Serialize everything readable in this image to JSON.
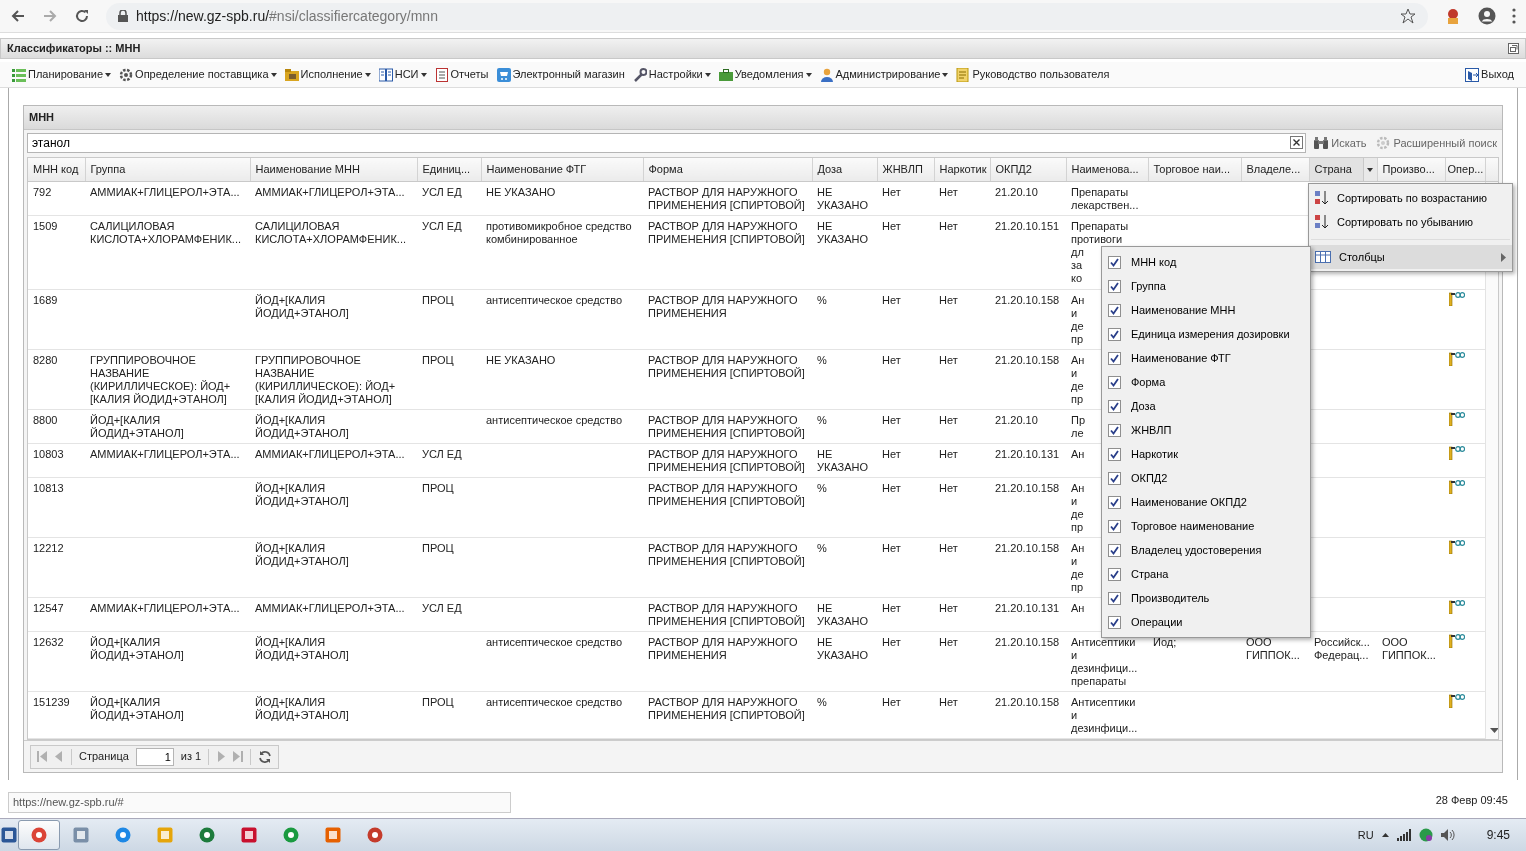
{
  "browser": {
    "url_host": "https://new.gz-spb.ru/",
    "url_path": "#nsi/classifiercategory/mnn"
  },
  "app": {
    "title": "Классификаторы :: МНН"
  },
  "menu": [
    {
      "label": "Планирование",
      "dropdown": true
    },
    {
      "label": "Определение поставщика",
      "dropdown": true
    },
    {
      "label": "Исполнение",
      "dropdown": true
    },
    {
      "label": "НСИ",
      "dropdown": true
    },
    {
      "label": "Отчеты",
      "dropdown": false
    },
    {
      "label": "Электронный магазин",
      "dropdown": false
    },
    {
      "label": "Настройки",
      "dropdown": true
    },
    {
      "label": "Уведомления",
      "dropdown": true
    },
    {
      "label": "Администрирование",
      "dropdown": true
    },
    {
      "label": "Руководство пользователя",
      "dropdown": false
    }
  ],
  "logout": "Выход",
  "panel": {
    "title": "МНН",
    "search_value": "этанол",
    "search_button": "Искать",
    "advanced_search": "Расширенный поиск"
  },
  "columns": [
    {
      "label": "МНН код",
      "menu_open": false
    },
    {
      "label": "Группа",
      "menu_open": false
    },
    {
      "label": "Наименование МНН",
      "menu_open": false
    },
    {
      "label": "Единиц...",
      "menu_open": false
    },
    {
      "label": "Наименование ФТГ",
      "menu_open": false
    },
    {
      "label": "Форма",
      "menu_open": false
    },
    {
      "label": "Доза",
      "menu_open": false
    },
    {
      "label": "ЖНВЛП",
      "menu_open": false
    },
    {
      "label": "Наркотик",
      "menu_open": false
    },
    {
      "label": "ОКПД2",
      "menu_open": false
    },
    {
      "label": "Наименова...",
      "menu_open": false
    },
    {
      "label": "Торговое наи...",
      "menu_open": false
    },
    {
      "label": "Владеле...",
      "menu_open": false
    },
    {
      "label": "Страна",
      "menu_open": true
    },
    {
      "label": "Произво...",
      "menu_open": false
    },
    {
      "label": "Опер...",
      "menu_open": false
    }
  ],
  "rows": [
    {
      "code": "792",
      "group": "АММИАК+ГЛИЦЕРОЛ+ЭТА...",
      "name": "АММИАК+ГЛИЦЕРОЛ+ЭТА...",
      "unit": "УСЛ ЕД",
      "ftg": "НЕ УКАЗАНО",
      "form": "РАСТВОР ДЛЯ НАРУЖНОГО ПРИМЕНЕНИЯ [СПИРТОВОЙ]",
      "dose": "НЕ УКАЗАНО",
      "vital": "Нет",
      "narcotic": "Нет",
      "okpd2": "21.20.10",
      "okpd2_name": "Препараты\nлекарствен..."
    },
    {
      "code": "1509",
      "group": "САЛИЦИЛОВАЯ КИСЛОТА+ХЛОРАМФЕНИК...",
      "name": "САЛИЦИЛОВАЯ КИСЛОТА+ХЛОРАМФЕНИК...",
      "unit": "УСЛ ЕД",
      "ftg": "противомикробное средство комбинированное",
      "form": "РАСТВОР ДЛЯ НАРУЖНОГО ПРИМЕНЕНИЯ [СПИРТОВОЙ]",
      "dose": "НЕ УКАЗАНО",
      "vital": "Нет",
      "narcotic": "Нет",
      "okpd2": "21.20.10.151",
      "okpd2_name": "Препараты\nпротивоги\nдл\nза\nко"
    },
    {
      "code": "1689",
      "name": "ЙОД+[КАЛИЯ ЙОДИД+ЭТАНОЛ]",
      "unit": "ПРОЦ",
      "ftg": "антисептическое средство",
      "form": "РАСТВОР ДЛЯ НАРУЖНОГО ПРИМЕНЕНИЯ",
      "dose": "%",
      "vital": "Нет",
      "narcotic": "Нет",
      "okpd2": "21.20.10.158",
      "okpd2_name": "Ан\nи\nде\nпр",
      "action_icon": true
    },
    {
      "code": "8280",
      "group": "ГРУППИРОВОЧНОЕ НАЗВАНИЕ (КИРИЛЛИЧЕСКОЕ): ЙОД+[КАЛИЯ ЙОДИД+ЭТАНОЛ]",
      "name": "ГРУППИРОВОЧНОЕ НАЗВАНИЕ (КИРИЛЛИЧЕСКОЕ): ЙОД+[КАЛИЯ ЙОДИД+ЭТАНОЛ]",
      "unit": "ПРОЦ",
      "ftg": "НЕ УКАЗАНО",
      "form": "РАСТВОР ДЛЯ НАРУЖНОГО ПРИМЕНЕНИЯ [СПИРТОВОЙ]",
      "dose": "%",
      "vital": "Нет",
      "narcotic": "Нет",
      "okpd2": "21.20.10.158",
      "okpd2_name": "Ан\nи\nде\nпр",
      "action_icon": true
    },
    {
      "code": "8800",
      "group": "ЙОД+[КАЛИЯ ЙОДИД+ЭТАНОЛ]",
      "name": "ЙОД+[КАЛИЯ ЙОДИД+ЭТАНОЛ]",
      "ftg": "антисептическое средство",
      "form": "РАСТВОР ДЛЯ НАРУЖНОГО ПРИМЕНЕНИЯ [СПИРТОВОЙ]",
      "dose": "%",
      "vital": "Нет",
      "narcotic": "Нет",
      "okpd2": "21.20.10",
      "okpd2_name": "Пр\nле",
      "action_icon": true
    },
    {
      "code": "10803",
      "group": "АММИАК+ГЛИЦЕРОЛ+ЭТА...",
      "name": "АММИАК+ГЛИЦЕРОЛ+ЭТА...",
      "unit": "УСЛ ЕД",
      "form": "РАСТВОР ДЛЯ НАРУЖНОГО ПРИМЕНЕНИЯ [СПИРТОВОЙ]",
      "dose": "НЕ УКАЗАНО",
      "vital": "Нет",
      "narcotic": "Нет",
      "okpd2": "21.20.10.131",
      "okpd2_name": "Ан",
      "action_icon": true
    },
    {
      "code": "10813",
      "name": "ЙОД+[КАЛИЯ ЙОДИД+ЭТАНОЛ]",
      "unit": "ПРОЦ",
      "form": "РАСТВОР ДЛЯ НАРУЖНОГО ПРИМЕНЕНИЯ [СПИРТОВОЙ]",
      "dose": "%",
      "vital": "Нет",
      "narcotic": "Нет",
      "okpd2": "21.20.10.158",
      "okpd2_name": "Ан\nи\nде\nпр",
      "action_icon": true
    },
    {
      "code": "12212",
      "name": "ЙОД+[КАЛИЯ ЙОДИД+ЭТАНОЛ]",
      "unit": "ПРОЦ",
      "form": "РАСТВОР ДЛЯ НАРУЖНОГО ПРИМЕНЕНИЯ [СПИРТОВОЙ]",
      "dose": "%",
      "vital": "Нет",
      "narcotic": "Нет",
      "okpd2": "21.20.10.158",
      "okpd2_name": "Ан\nи\nде\nпр",
      "action_icon": true
    },
    {
      "code": "12547",
      "group": "АММИАК+ГЛИЦЕРОЛ+ЭТА...",
      "name": "АММИАК+ГЛИЦЕРОЛ+ЭТА...",
      "unit": "УСЛ ЕД",
      "form": "РАСТВОР ДЛЯ НАРУЖНОГО ПРИМЕНЕНИЯ [СПИРТОВОЙ]",
      "dose": "НЕ УКАЗАНО",
      "vital": "Нет",
      "narcotic": "Нет",
      "okpd2": "21.20.10.131",
      "okpd2_name": "Ан",
      "action_icon": true
    },
    {
      "code": "12632",
      "group": "ЙОД+[КАЛИЯ ЙОДИД+ЭТАНОЛ]",
      "name": "ЙОД+[КАЛИЯ ЙОДИД+ЭТАНОЛ]",
      "ftg": "антисептическое средство",
      "form": "РАСТВОР ДЛЯ НАРУЖНОГО ПРИМЕНЕНИЯ",
      "dose": "НЕ УКАЗАНО",
      "vital": "Нет",
      "narcotic": "Нет",
      "okpd2": "21.20.10.158",
      "okpd2_name": "Антисептики\nи\nдезинфици...\nпрепараты",
      "trade_name": "Йод;",
      "owner": "ООО ГИППОК...",
      "country": "Российск... Федерац...",
      "maker": "ООО ГИППОК...",
      "action_icon": true
    },
    {
      "code": "151239",
      "group": "ЙОД+[КАЛИЯ ЙОДИД+ЭТАНОЛ]",
      "name": "ЙОД+[КАЛИЯ ЙОДИД+ЭТАНОЛ]",
      "unit": "ПРОЦ",
      "ftg": "антисептическое средство",
      "form": "РАСТВОР ДЛЯ НАРУЖНОГО ПРИМЕНЕНИЯ [СПИРТОВОЙ]",
      "dose": "%",
      "vital": "Нет",
      "narcotic": "Нет",
      "okpd2": "21.20.10.158",
      "okpd2_name": "Антисептики\nи\nдезинфици...",
      "action_icon": true
    }
  ],
  "column_menu": [
    {
      "kind": "sort-asc",
      "label": "Сортировать по возрастанию",
      "selected": false
    },
    {
      "kind": "sort-desc",
      "label": "Сортировать по убыванию",
      "selected": false
    },
    {
      "kind": "submenu",
      "label": "Столбцы",
      "selected": true
    }
  ],
  "columns_submenu": [
    {
      "label": "МНН код",
      "checked": true
    },
    {
      "label": "Группа",
      "checked": true
    },
    {
      "label": "Наименование МНН",
      "checked": true
    },
    {
      "label": "Единица измерения дозировки",
      "checked": true
    },
    {
      "label": "Наименование ФТГ",
      "checked": true
    },
    {
      "label": "Форма",
      "checked": true
    },
    {
      "label": "Доза",
      "checked": true
    },
    {
      "label": "ЖНВЛП",
      "checked": true
    },
    {
      "label": "Наркотик",
      "checked": true
    },
    {
      "label": "ОКПД2",
      "checked": true
    },
    {
      "label": "Наименование ОКПД2",
      "checked": true
    },
    {
      "label": "Торговое наименование",
      "checked": true
    },
    {
      "label": "Владелец удостоверения",
      "checked": true
    },
    {
      "label": "Страна",
      "checked": true
    },
    {
      "label": "Производитель",
      "checked": true
    },
    {
      "label": "Операции",
      "checked": true
    }
  ],
  "pager": {
    "page_label": "Страница",
    "page": "1",
    "total": "из 1",
    "nav_disabled": true
  },
  "status_bar": {
    "link": "https://new.gz-spb.ru/#",
    "datetime": "28 Февр 09:45"
  },
  "taskbar": {
    "apps": [
      {
        "selected": false
      },
      {
        "selected": true
      },
      {
        "selected": false
      },
      {
        "selected": false
      },
      {
        "selected": false
      },
      {
        "selected": false
      },
      {
        "selected": false
      },
      {
        "selected": false
      },
      {
        "selected": false
      },
      {
        "selected": false
      }
    ],
    "language": "RU",
    "clock": "9:45"
  }
}
